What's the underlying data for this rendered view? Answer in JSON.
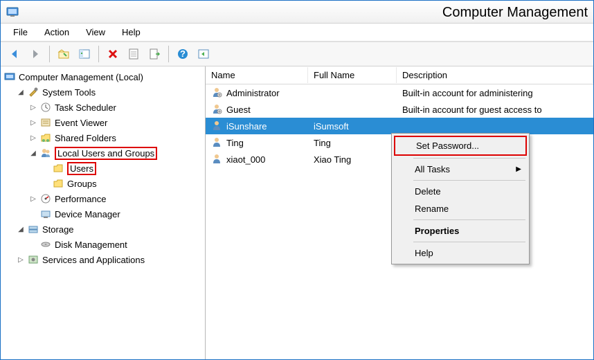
{
  "window": {
    "title": "Computer Management"
  },
  "menubar": {
    "file": "File",
    "action": "Action",
    "view": "View",
    "help": "Help"
  },
  "tree": {
    "root": "Computer Management (Local)",
    "system_tools": "System Tools",
    "task_scheduler": "Task Scheduler",
    "event_viewer": "Event Viewer",
    "shared_folders": "Shared Folders",
    "local_users_groups": "Local Users and Groups",
    "users": "Users",
    "groups": "Groups",
    "performance": "Performance",
    "device_manager": "Device Manager",
    "storage": "Storage",
    "disk_management": "Disk Management",
    "services_apps": "Services and Applications"
  },
  "columns": {
    "name": "Name",
    "full": "Full Name",
    "desc": "Description"
  },
  "rows": [
    {
      "name": "Administrator",
      "full": "",
      "desc": "Built-in account for administering"
    },
    {
      "name": "Guest",
      "full": "",
      "desc": "Built-in account for guest access to"
    },
    {
      "name": "iSunshare",
      "full": "iSumsoft",
      "desc": ""
    },
    {
      "name": "Ting",
      "full": "Ting",
      "desc": ""
    },
    {
      "name": "xiaot_000",
      "full": "Xiao Ting",
      "desc": ""
    }
  ],
  "ctx": {
    "set_password": "Set Password...",
    "all_tasks": "All Tasks",
    "delete": "Delete",
    "rename": "Rename",
    "properties": "Properties",
    "help": "Help"
  }
}
